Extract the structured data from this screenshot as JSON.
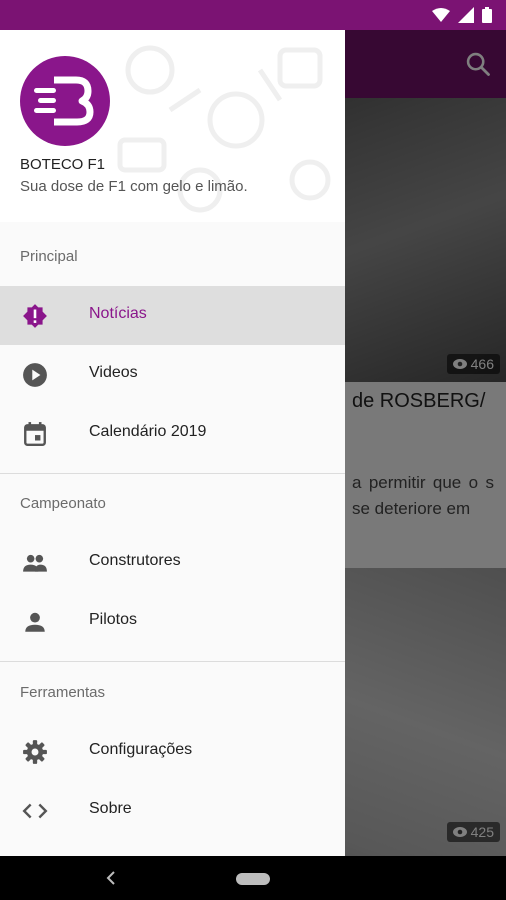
{
  "drawer": {
    "app_name": "BOTECO F1",
    "tagline": "Sua dose de F1 com gelo e limão.",
    "sections": [
      {
        "title": "Principal",
        "items": [
          {
            "label": "Notícias",
            "icon": "alert-badge-icon",
            "active": true
          },
          {
            "label": "Videos",
            "icon": "play-circle-icon",
            "active": false
          },
          {
            "label": "Calendário 2019",
            "icon": "calendar-icon",
            "active": false
          }
        ]
      },
      {
        "title": "Campeonato",
        "items": [
          {
            "label": "Construtores",
            "icon": "people-icon",
            "active": false
          },
          {
            "label": "Pilotos",
            "icon": "person-icon",
            "active": false
          }
        ]
      },
      {
        "title": "Ferramentas",
        "items": [
          {
            "label": "Configurações",
            "icon": "gear-icon",
            "active": false
          },
          {
            "label": "Sobre",
            "icon": "code-icon",
            "active": false
          }
        ]
      }
    ]
  },
  "feed": {
    "card1_views": "466",
    "card1_title_fragment": "de ROSBERG/",
    "card1_excerpt_fragment": "a permitir que o s se deteriore em",
    "card2_views": "425"
  },
  "colors": {
    "accent": "#8a168b",
    "appbar": "#6f1067",
    "statusbar": "#7b1373"
  }
}
